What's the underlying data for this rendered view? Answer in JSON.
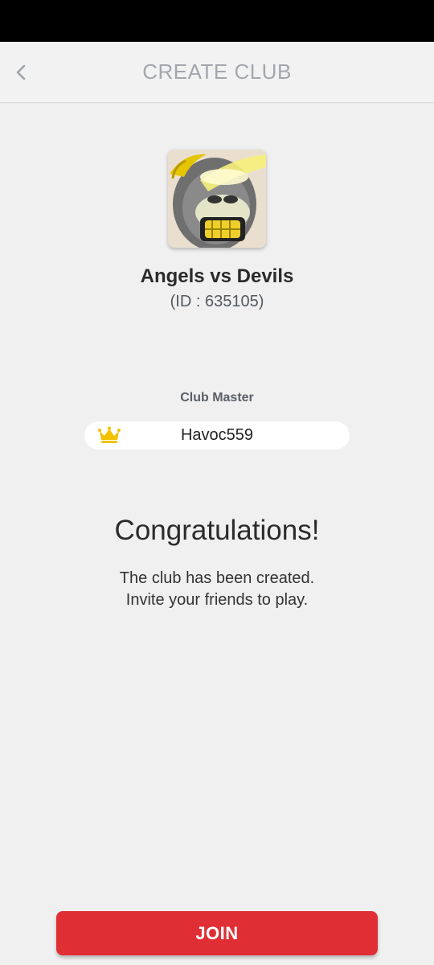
{
  "header": {
    "title": "CREATE CLUB",
    "back_icon": "chevron-left-icon"
  },
  "club": {
    "name": "Angels vs Devils",
    "id_text": "(ID : 635105)",
    "avatar": "ape-avatar-image"
  },
  "master": {
    "label": "Club Master",
    "name": "Havoc559",
    "icon": "crown-icon"
  },
  "message": {
    "title": "Congratulations!",
    "line1": "The club has been created.",
    "line2": "Invite your friends to play."
  },
  "actions": {
    "join_label": "JOIN"
  },
  "colors": {
    "background": "#f0f0f0",
    "accent": "#df2f35",
    "crown": "#f2c200",
    "header_text": "#a3a7ad"
  }
}
